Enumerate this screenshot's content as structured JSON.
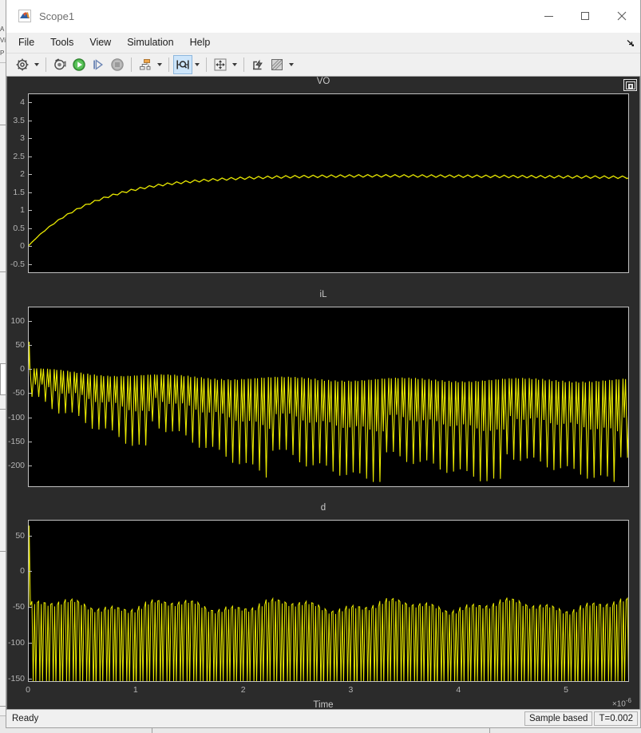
{
  "window": {
    "title": "Scope1",
    "app_icon": "matlab-scope-icon",
    "controls": {
      "minimize": "Minimize",
      "maximize": "Maximize",
      "close": "Close"
    }
  },
  "menubar": {
    "items": [
      {
        "label": "File",
        "name": "menu-file"
      },
      {
        "label": "Tools",
        "name": "menu-tools"
      },
      {
        "label": "View",
        "name": "menu-view"
      },
      {
        "label": "Simulation",
        "name": "menu-simulation"
      },
      {
        "label": "Help",
        "name": "menu-help"
      }
    ],
    "overflow_icon": "overflow-arrow-icon"
  },
  "toolbar": {
    "buttons": [
      {
        "name": "configuration-properties-button",
        "icon": "gear-icon",
        "has_dropdown": true,
        "active": false
      },
      {
        "name": "print-button",
        "icon": "print-icon",
        "has_dropdown": false,
        "active": false
      },
      {
        "name": "run-button",
        "icon": "play-icon",
        "has_dropdown": false,
        "active": false
      },
      {
        "name": "step-forward-button",
        "icon": "step-forward-icon",
        "has_dropdown": false,
        "active": false
      },
      {
        "name": "stop-button",
        "icon": "stop-icon",
        "has_dropdown": false,
        "active": false
      },
      {
        "name": "layout-button",
        "icon": "layout-icon",
        "has_dropdown": true,
        "active": false
      },
      {
        "name": "cursor-measurements-button",
        "icon": "cursor-measure-icon",
        "has_dropdown": true,
        "active": true
      },
      {
        "name": "zoom-pan-button",
        "icon": "pan-arrows-icon",
        "has_dropdown": true,
        "active": false
      },
      {
        "name": "autoscale-button",
        "icon": "autoscale-icon",
        "has_dropdown": false,
        "active": false
      },
      {
        "name": "style-button",
        "icon": "style-ruler-icon",
        "has_dropdown": true,
        "active": false
      }
    ]
  },
  "plot": {
    "float_button": "undock-icon",
    "background_color": "#2b2b2b",
    "axes_background": "#000000",
    "trace_color": "#e8e800",
    "grid_color": "#c0c0c0",
    "xlabel": "Time",
    "x_exponent_prefix": "×10",
    "x_exponent_power": "-6"
  },
  "chart_data": [
    {
      "type": "line",
      "name": "subplot-vo",
      "title": "VO",
      "xlabel": "",
      "ylabel": "",
      "xlim": [
        0,
        5.6
      ],
      "ylim": [
        -0.75,
        4.25
      ],
      "xticks": [
        0,
        1,
        2,
        3,
        4,
        5
      ],
      "yticks": [
        4,
        3.5,
        3,
        2.5,
        2,
        1.5,
        1,
        0.5,
        0,
        -0.5
      ],
      "ytick_labels": [
        "4",
        "3.5",
        "3",
        "2.5",
        "2",
        "1.5",
        "1",
        "0.5",
        "0",
        "-0.5"
      ],
      "grid": false,
      "series": [
        {
          "name": "VO",
          "color": "#e8e800",
          "description": "Exponential rise from 0 to steady-state ~1.97 with small switching ripple (~0.07 pk-pk) superimposed; slight droop after t=3.5e-6",
          "steady_state": 1.97,
          "time_constant_us": 0.62,
          "ripple_amplitude": 0.035,
          "ripple_period_us": 0.085,
          "start_value": 0.0
        }
      ]
    },
    {
      "type": "line",
      "name": "subplot-il",
      "title": "iL",
      "xlabel": "",
      "ylabel": "",
      "xlim": [
        0,
        5.6
      ],
      "ylim": [
        -245,
        130
      ],
      "xticks": [
        0,
        1,
        2,
        3,
        4,
        5
      ],
      "yticks": [
        100,
        50,
        0,
        -50,
        -100,
        -150,
        -200
      ],
      "ytick_labels": [
        "100",
        "50",
        "0",
        "-50",
        "-100",
        "-150",
        "-200"
      ],
      "grid": false,
      "series": [
        {
          "name": "iL",
          "color": "#e8e800",
          "description": "Initial spike to +58 then fast triangular switching oscillation; upper envelope decays from ~0 to ~-25, lower envelope sweeps down with a beating pattern repeating roughly every 1.1e-6 s reaching about -230",
          "initial_spike": 58,
          "upper_envelope": [
            0,
            -8,
            -14,
            -20,
            -24,
            -24,
            -22
          ],
          "lower_envelope_min": -232,
          "switching_period_us": 0.0625,
          "beat_period_us": 1.1
        }
      ]
    },
    {
      "type": "line",
      "name": "subplot-d",
      "title": "d",
      "xlabel": "Time",
      "ylabel": "",
      "xlim": [
        0,
        5.6
      ],
      "ylim": [
        -155,
        72
      ],
      "xticks": [
        0,
        1,
        2,
        3,
        4,
        5
      ],
      "yticks": [
        50,
        0,
        -50,
        -100,
        -150
      ],
      "ytick_labels": [
        "50",
        "0",
        "-50",
        "-100",
        "-150"
      ],
      "grid": false,
      "series": [
        {
          "name": "d",
          "color": "#e8e800",
          "description": "Initial spike to +65 then narrow downward pulses from a ceiling near -45 to -55 diving below -150, repeating at the switching period with occasional deeper/shallower groups",
          "initial_spike": 65,
          "ceiling": -47,
          "floor": -155,
          "pulse_period_us": 0.0625
        }
      ]
    }
  ],
  "statusbar": {
    "message": "Ready",
    "cells": [
      {
        "name": "status-sample-mode",
        "label": "Sample based"
      },
      {
        "name": "status-time",
        "label": "T=0.002"
      }
    ]
  },
  "background_window": {
    "left_labels": [
      "A",
      "Vi",
      "P"
    ]
  }
}
